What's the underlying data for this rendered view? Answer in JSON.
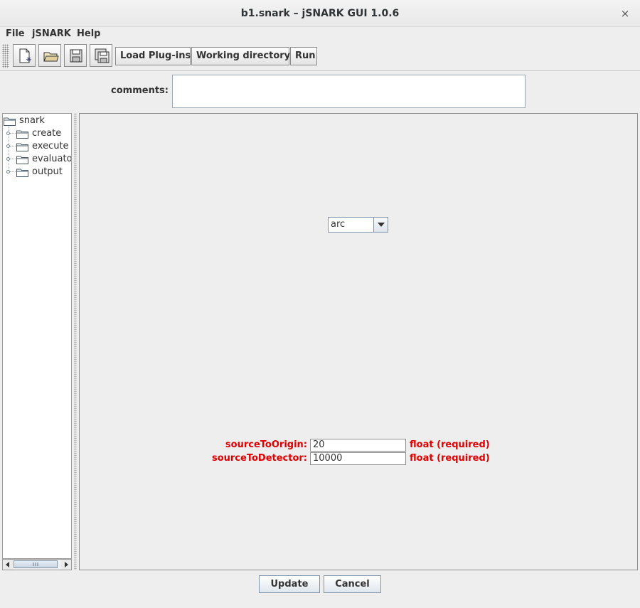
{
  "window": {
    "title": "b1.snark – jSNARK GUI 1.0.6",
    "close_glyph": "×"
  },
  "menu": [
    "File",
    "jSNARK",
    "Help"
  ],
  "toolbar": {
    "icons": [
      "new-file-icon",
      "open-folder-icon",
      "save-icon",
      "save-as-icon"
    ],
    "buttons": [
      "Load Plug-ins",
      "Working directory",
      "Run"
    ]
  },
  "comments": {
    "label": "comments:",
    "value": ""
  },
  "tree": {
    "root": "snark",
    "children": [
      "create",
      "execute",
      "evaluator",
      "output"
    ]
  },
  "main": {
    "combo_value": "arc",
    "params": [
      {
        "label": "sourceToOrigin:",
        "value": "20",
        "type": "float (required)"
      },
      {
        "label": "sourceToDetector:",
        "value": "10000",
        "type": "float (required)"
      }
    ]
  },
  "footer": {
    "update_label": "Update",
    "cancel_label": "Cancel"
  },
  "colors": {
    "required_text": "#e00000",
    "accent_border": "#7f95ad"
  }
}
